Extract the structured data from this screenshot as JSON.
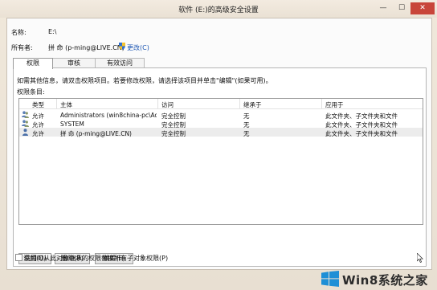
{
  "window": {
    "title": "软件 (E:)的高级安全设置",
    "minimize_glyph": "—",
    "maximize_glyph": "☐",
    "close_glyph": "✕"
  },
  "info": {
    "name_label": "名称:",
    "name_value": "E:\\",
    "owner_label": "所有者:",
    "owner_value": "拼 命 (p-ming@LIVE.CN)",
    "change_link": "更改(C)"
  },
  "tabs": [
    {
      "label": "权限",
      "active": true
    },
    {
      "label": "审核",
      "active": false
    },
    {
      "label": "有效访问",
      "active": false
    }
  ],
  "panel": {
    "hint": "如需其他信息，请双击权限项目。若要修改权限，请选择该项目并单击\"编辑\"(如果可用)。",
    "entries_label": "权限条目:"
  },
  "table": {
    "headers": [
      "类型",
      "主体",
      "访问",
      "继承于",
      "应用于"
    ],
    "rows": [
      {
        "type": "允许",
        "principal": "Administrators (win8china-pc\\Adm...",
        "access": "完全控制",
        "inherited": "无",
        "applies": "此文件夹、子文件夹和文件",
        "icon": "group-icon"
      },
      {
        "type": "允许",
        "principal": "SYSTEM",
        "access": "完全控制",
        "inherited": "无",
        "applies": "此文件夹、子文件夹和文件",
        "icon": "group-icon"
      },
      {
        "type": "允许",
        "principal": "拼 命 (p-ming@LIVE.CN)",
        "access": "完全控制",
        "inherited": "无",
        "applies": "此文件夹、子文件夹和文件",
        "icon": "user-icon"
      }
    ]
  },
  "buttons": {
    "add": "添加(D)",
    "remove": "删除(R)",
    "edit": "编辑(E)"
  },
  "checkbox": {
    "label": "使用可从此对象继承的权限替换所有子对象权限(P)",
    "checked": false
  },
  "watermark": {
    "text": "Win8系统之家"
  },
  "colors": {
    "link": "#1c56b3",
    "close_button": "#c8453a",
    "win_logo": "#1e8fd6"
  }
}
